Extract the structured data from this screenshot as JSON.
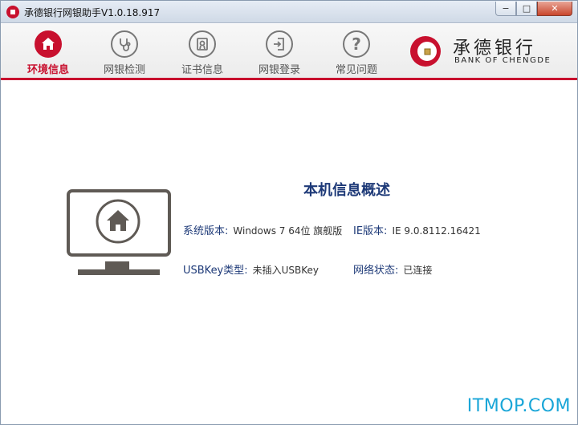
{
  "window": {
    "title": "承德银行网银助手V1.0.18.917",
    "controls": {
      "minimize": "−",
      "maximize": "□",
      "close": "✕"
    }
  },
  "toolbar": {
    "items": [
      {
        "label": "环境信息",
        "icon": "home-icon",
        "active": true
      },
      {
        "label": "网银检测",
        "icon": "stethoscope-icon",
        "active": false
      },
      {
        "label": "证书信息",
        "icon": "certificate-icon",
        "active": false
      },
      {
        "label": "网银登录",
        "icon": "login-icon",
        "active": false
      },
      {
        "label": "常见问题",
        "icon": "question-icon",
        "active": false
      }
    ]
  },
  "logo": {
    "cn": "承德银行",
    "en": "BANK OF CHENGDE"
  },
  "overview": {
    "title": "本机信息概述",
    "system_version_label": "系统版本:",
    "system_version_value": "Windows 7 64位 旗舰版",
    "ie_version_label": "IE版本:",
    "ie_version_value": "IE 9.0.8112.16421",
    "usbkey_label": "USBKey类型:",
    "usbkey_value": "未插入USBKey",
    "network_label": "网络状态:",
    "network_value": "已连接"
  },
  "watermark": "ITMOP.COM",
  "colors": {
    "accent": "#c8102e",
    "label_blue": "#1e3a78",
    "icon_gray": "#5f5a55"
  }
}
